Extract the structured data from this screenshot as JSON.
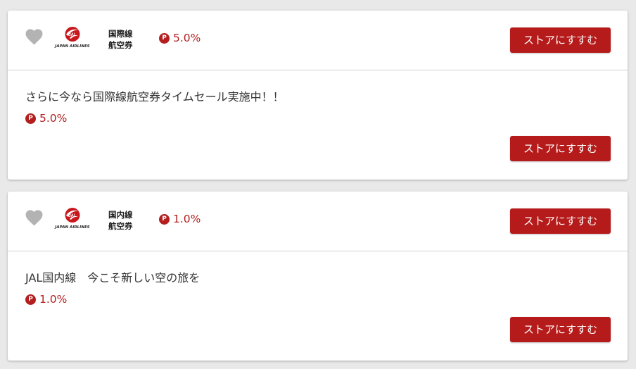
{
  "button_label": "ストアにすすむ",
  "point_icon_letter": "P",
  "logo_text": "JAPAN AIRLINES",
  "colors": {
    "accent": "#b51b1b",
    "rate": "#b31f1f",
    "heart": "#b3b3b3",
    "background": "#e9e9e9"
  },
  "cards": [
    {
      "store_name_line1": "国際線",
      "store_name_line2": "航空券",
      "rate": "5.0%",
      "description": "さらに今なら国際線航空券タイムセール実施中！！",
      "description_rate": "5.0%",
      "favorite_icon": "heart-icon"
    },
    {
      "store_name_line1": "国内線",
      "store_name_line2": "航空券",
      "rate": "1.0%",
      "description": "JAL国内線　今こそ新しい空の旅を",
      "description_rate": "1.0%",
      "favorite_icon": "heart-icon"
    }
  ]
}
